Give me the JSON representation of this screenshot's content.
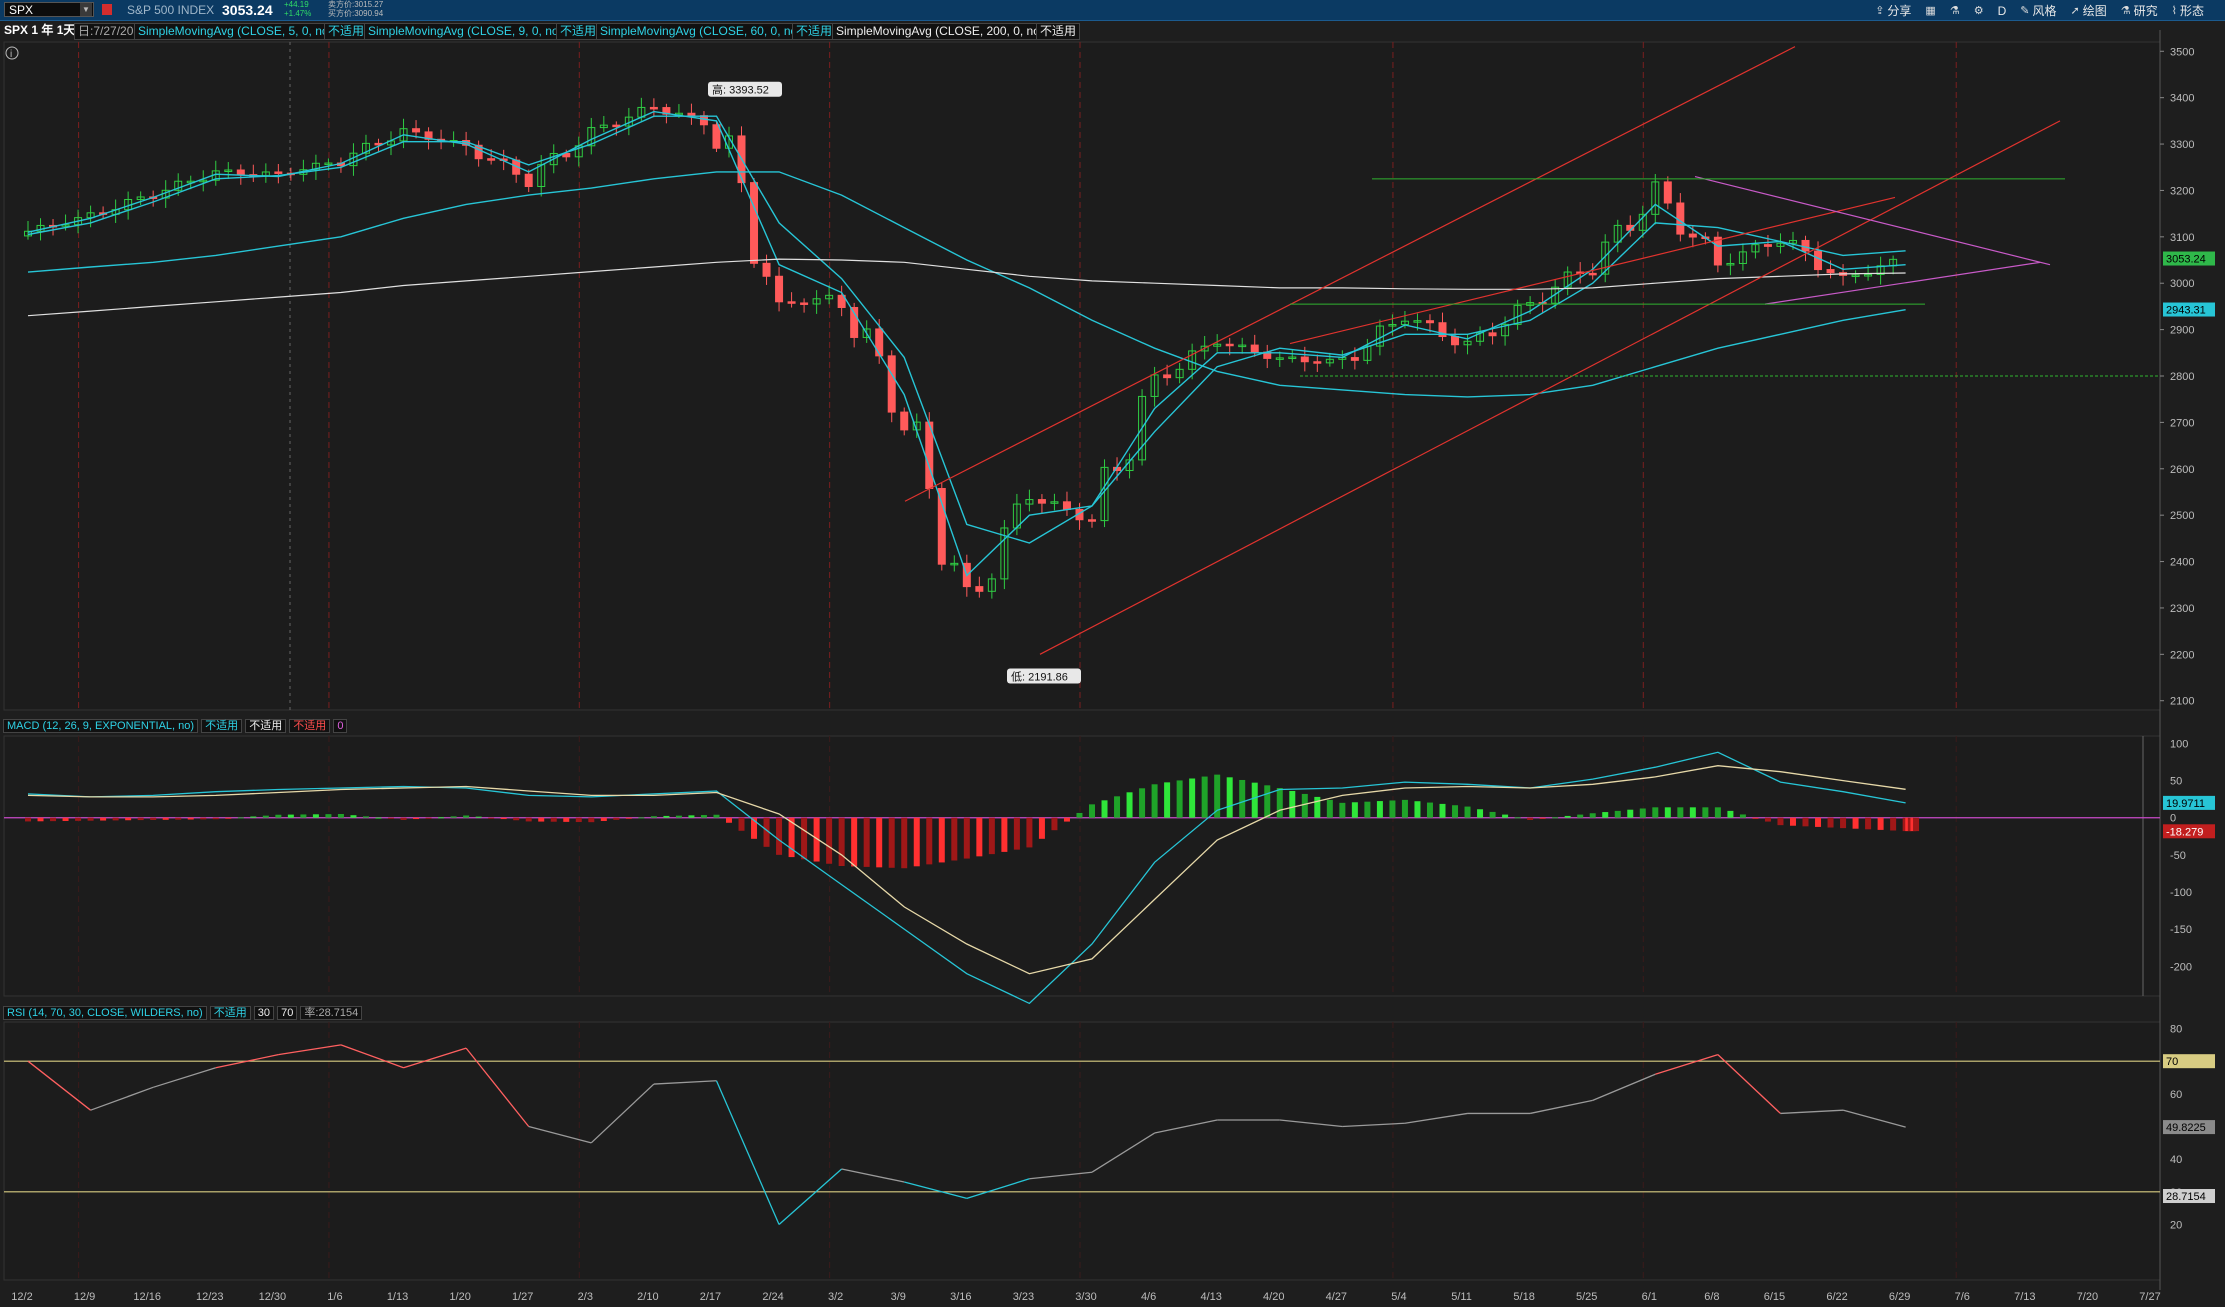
{
  "toolbar": {
    "symbol": "SPX",
    "index_name": "S&P 500 INDEX",
    "price": "3053.24",
    "change": "+44.19",
    "change_pct": "+1.47%",
    "bid": "卖方价:3015.27",
    "ask": "买方价:3090.94",
    "buttons": [
      "分享",
      "D",
      "风格",
      "绘图",
      "研究",
      "形态"
    ],
    "icons": [
      "share-icon",
      "calendar-icon",
      "flask-icon",
      "gear-icon",
      "style-icon",
      "drawing-icon",
      "studies-icon",
      "pattern-icon"
    ]
  },
  "studybar": {
    "title": "SPX 1 年 1天",
    "date": "日:7/27/20",
    "items": [
      {
        "label": "SimpleMovingAvg (CLOSE, 5, 0, no)",
        "value": "不适用",
        "color": "#2fd2e6"
      },
      {
        "label": "SimpleMovingAvg (CLOSE, 9, 0, no)",
        "value": "不适用",
        "color": "#2fd2e6"
      },
      {
        "label": "SimpleMovingAvg (CLOSE, 60, 0, no)",
        "value": "不适用",
        "color": "#2fd2e6"
      },
      {
        "label": "SimpleMovingAvg (CLOSE, 200, 0, no)",
        "value": "不适用",
        "color": "#eeeeee"
      }
    ]
  },
  "macd_bar": {
    "label": "MACD (12, 26, 9, EXPONENTIAL, no)",
    "values": [
      "不适用",
      "不适用",
      "不适用",
      "0"
    ]
  },
  "rsi_bar": {
    "label": "RSI (14, 70, 30, CLOSE, WILDERS, no)",
    "values": [
      "不适用",
      "30",
      "70",
      "率:28.7154"
    ]
  },
  "chart_data": [
    {
      "type": "candlestick",
      "title": "SPX 1 年 1天",
      "x": [
        "12/2",
        "12/9",
        "12/16",
        "12/23",
        "12/30",
        "1/6",
        "1/13",
        "1/20",
        "1/27",
        "2/3",
        "2/10",
        "2/17",
        "2/24",
        "3/2",
        "3/9",
        "3/16",
        "3/23",
        "3/30",
        "4/6",
        "4/13",
        "4/20",
        "4/27",
        "5/4",
        "5/11",
        "5/18",
        "5/25",
        "6/1",
        "6/8",
        "6/15",
        "6/22",
        "6/29",
        "7/6",
        "7/13",
        "7/20",
        "7/27"
      ],
      "ylim": [
        2080,
        3520
      ],
      "y_ticks": [
        2100,
        2200,
        2300,
        2400,
        2500,
        2600,
        2700,
        2800,
        2900,
        3000,
        3100,
        3200,
        3300,
        3400,
        3500
      ],
      "weekly_close": [
        3112,
        3145,
        3192,
        3240,
        3234,
        3265,
        3329,
        3295,
        3225,
        3327,
        3380,
        3338,
        2954,
        2972,
        2711,
        2305,
        2541,
        2489,
        2790,
        2875,
        2837,
        2830,
        2930,
        2864,
        2955,
        3044,
        3194,
        3041,
        3097,
        3009,
        3053
      ],
      "series": [
        {
          "name": "SimpleMovingAvg (CLOSE, 5, 0, no)",
          "values": [
            3110,
            3140,
            3185,
            3235,
            3230,
            3258,
            3320,
            3300,
            3240,
            3310,
            3370,
            3350,
            3040,
            2980,
            2760,
            2370,
            2500,
            2520,
            2730,
            2850,
            2850,
            2840,
            2910,
            2880,
            2940,
            3030,
            3170,
            3080,
            3090,
            3030,
            3040
          ]
        },
        {
          "name": "SimpleMovingAvg (CLOSE, 9, 0, no)",
          "values": [
            3105,
            3130,
            3175,
            3225,
            3232,
            3250,
            3305,
            3305,
            3255,
            3300,
            3360,
            3360,
            3130,
            3010,
            2840,
            2480,
            2440,
            2520,
            2680,
            2820,
            2860,
            2845,
            2890,
            2890,
            2920,
            3000,
            3130,
            3120,
            3090,
            3060,
            3070
          ]
        },
        {
          "name": "SimpleMovingAvg (CLOSE, 60, 0, no)",
          "values": [
            3024,
            3035,
            3045,
            3060,
            3080,
            3100,
            3140,
            3170,
            3190,
            3205,
            3225,
            3240,
            3240,
            3190,
            3120,
            3050,
            2990,
            2920,
            2860,
            2810,
            2780,
            2770,
            2760,
            2755,
            2760,
            2780,
            2820,
            2860,
            2890,
            2920,
            2943
          ]
        },
        {
          "name": "SimpleMovingAvg (CLOSE, 200, 0, no)",
          "values": [
            2930,
            2940,
            2950,
            2960,
            2970,
            2980,
            2995,
            3005,
            3015,
            3025,
            3035,
            3045,
            3052,
            3050,
            3045,
            3030,
            3015,
            3005,
            3000,
            2995,
            2990,
            2990,
            2988,
            2987,
            2987,
            2990,
            3000,
            3010,
            3015,
            3020,
            3022
          ]
        }
      ],
      "annotations": [
        "高: 3393.52",
        "低: 2191.86"
      ],
      "price_labels": [
        "3053.24",
        "2943.31"
      ],
      "colors": {
        "up": "#2fcc43",
        "down": "#ff5a5a",
        "ma_cyan": "#27c5d6",
        "ma_white": "#e0e0e0",
        "trend_red": "#e0332e",
        "trend_magenta": "#c85ac8",
        "level_green": "#2fb32f"
      }
    },
    {
      "type": "bar",
      "title": "MACD (12, 26, 9, EXPONENTIAL, no)",
      "ylim": [
        -240,
        110
      ],
      "y_ticks": [
        100,
        50,
        0,
        -50,
        -100,
        -150,
        -200
      ],
      "histogram": [
        -5,
        -4,
        -3,
        -2,
        4,
        5,
        -3,
        3,
        -5,
        -6,
        2,
        4,
        -50,
        -65,
        -68,
        -55,
        -40,
        18,
        45,
        58,
        40,
        20,
        24,
        15,
        -3,
        6,
        14,
        14,
        -10,
        -14,
        -18
      ],
      "series": [
        {
          "name": "Value",
          "values": [
            32,
            28,
            30,
            35,
            38,
            40,
            42,
            40,
            30,
            28,
            32,
            36,
            -30,
            -90,
            -150,
            -210,
            -250,
            -170,
            -60,
            10,
            38,
            40,
            48,
            45,
            40,
            52,
            68,
            88,
            48,
            35,
            19.9711
          ]
        },
        {
          "name": "Avg",
          "values": [
            30,
            28,
            28,
            30,
            34,
            38,
            40,
            42,
            36,
            30,
            30,
            34,
            5,
            -50,
            -120,
            -170,
            -210,
            -190,
            -110,
            -30,
            10,
            30,
            40,
            42,
            40,
            45,
            55,
            70,
            62,
            50,
            38.25
          ]
        }
      ],
      "price_labels": [
        "19.9711",
        "-18.279"
      ]
    },
    {
      "type": "line",
      "title": "RSI (14, 70, 30, CLOSE, WILDERS, no)",
      "ylim": [
        3,
        82
      ],
      "y_ticks": [
        80,
        70,
        60,
        50,
        40,
        30,
        20
      ],
      "levels": [
        70,
        30
      ],
      "series": [
        {
          "name": "RSI",
          "values": [
            70,
            55,
            62,
            68,
            72,
            75,
            68,
            74,
            50,
            45,
            63,
            64,
            20,
            37,
            33,
            28,
            34,
            36,
            48,
            52,
            52,
            50,
            51,
            54,
            54,
            58,
            66,
            72,
            54,
            55,
            49.82
          ]
        }
      ],
      "price_labels": [
        "49.8225",
        "28.7154"
      ]
    }
  ]
}
